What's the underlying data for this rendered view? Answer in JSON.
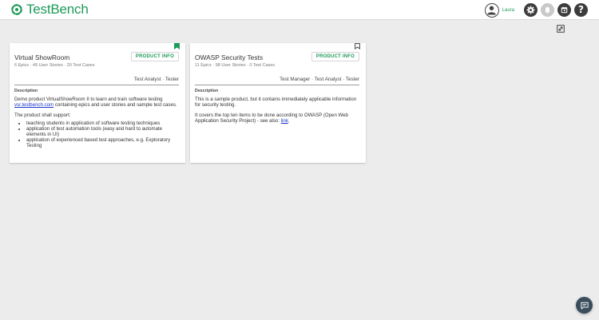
{
  "app": {
    "name": "TestBench",
    "brand_color": "#1e9b5a"
  },
  "header": {
    "username": "Laura",
    "icons": [
      "user-icon",
      "settings-gear-icon",
      "notification-bell-icon",
      "calendar-icon",
      "help-icon"
    ],
    "help_glyph": "?"
  },
  "cards": [
    {
      "title": "Virtual ShowRoom",
      "subtitle": "6 Epics · 49 User Stories · 20 Test Cases",
      "info_label": "PRODUCT INFO",
      "roles": "Test Analyst · Tester",
      "bookmarked": true,
      "desc_heading": "Description",
      "desc_p1_before": "Demo product VirtualShowRoom II to learn and train software testing ",
      "desc_p1_link": "vsr.testbench.com",
      "desc_p1_after": " containing epics and user stories and sample test cases.",
      "desc_p2": "The product shall support:",
      "desc_list": [
        "teaching students in application of software testing techniques",
        "application of test automation tools (easy and hard to automate elements in UI)",
        "application of experienced based test approaches, e.g. Exploratory Testing"
      ]
    },
    {
      "title": "OWASP Security Tests",
      "subtitle": "11 Epics · 98 User Stories · 0 Test Cases",
      "info_label": "PRODUCT INFO",
      "roles": "Test Manager · Test Analyst · Tester",
      "bookmarked": false,
      "desc_heading": "Description",
      "desc_p1": "This is a sample product, but it contains immediately applicable information for security testing.",
      "desc_p2_before": "It covers the top ten items to be done according to OWASP (Open Web Application Security Project) - see also: ",
      "desc_p2_link": "link",
      "desc_p2_after": "."
    }
  ]
}
